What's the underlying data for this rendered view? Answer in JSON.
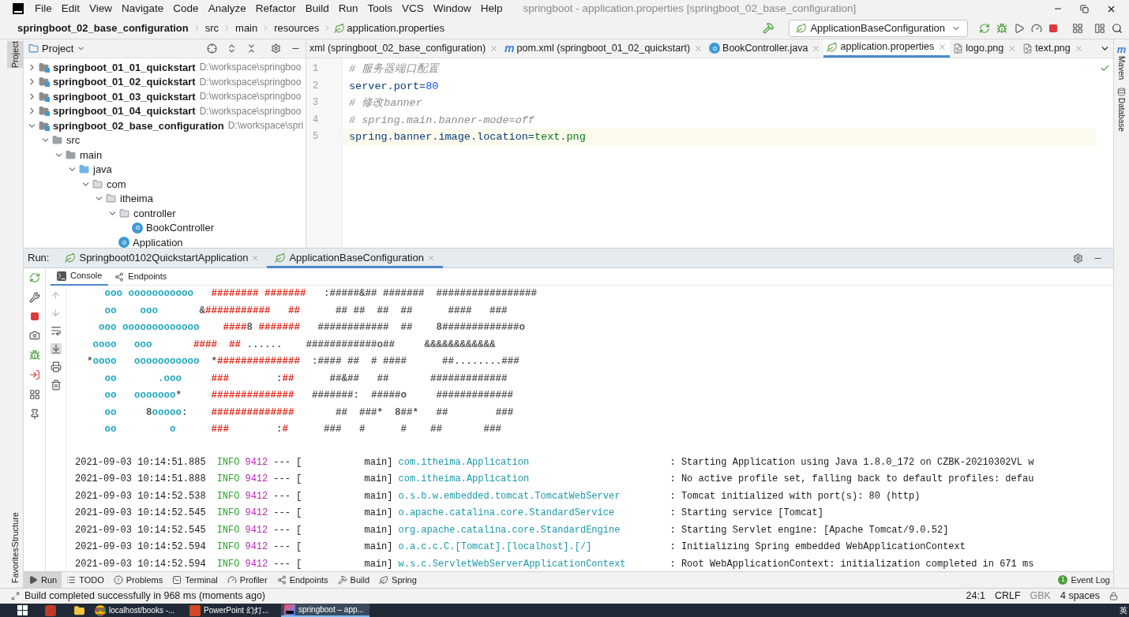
{
  "menu": [
    "File",
    "Edit",
    "View",
    "Navigate",
    "Code",
    "Analyze",
    "Refactor",
    "Build",
    "Run",
    "Tools",
    "VCS",
    "Window",
    "Help"
  ],
  "window_title": "springboot - application.properties [springboot_02_base_configuration]",
  "breadcrumb": [
    "springboot_02_base_configuration",
    "src",
    "main",
    "resources",
    "application.properties"
  ],
  "run_config": "ApplicationBaseConfiguration",
  "left_strip": {
    "top": [
      {
        "label": "Project",
        "selected": true
      }
    ],
    "bottom": [
      {
        "label": "Structure",
        "selected": false
      },
      {
        "label": "Favorites",
        "selected": false
      }
    ]
  },
  "right_strip": [
    {
      "label": "Maven",
      "kind": "maven",
      "icon_text": "m"
    },
    {
      "label": "Database",
      "kind": "database"
    }
  ],
  "project_panel": {
    "title": "Project",
    "tree": [
      {
        "label": "springboot_01_01_quickstart",
        "path": "D:\\workspace\\springboo",
        "kind": "module",
        "expanded": false
      },
      {
        "label": "springboot_01_02_quickstart",
        "path": "D:\\workspace\\springboo",
        "kind": "module",
        "expanded": false
      },
      {
        "label": "springboot_01_03_quickstart",
        "path": "D:\\workspace\\springboo",
        "kind": "module",
        "expanded": false
      },
      {
        "label": "springboot_01_04_quickstart",
        "path": "D:\\workspace\\springboo",
        "kind": "module",
        "expanded": false
      },
      {
        "label": "springboot_02_base_configuration",
        "path": "D:\\workspace\\spri",
        "kind": "module",
        "expanded": true,
        "children": [
          {
            "label": "src",
            "kind": "folder",
            "expanded": true,
            "children": [
              {
                "label": "main",
                "kind": "folder",
                "expanded": true,
                "children": [
                  {
                    "label": "java",
                    "kind": "source",
                    "expanded": true,
                    "children": [
                      {
                        "label": "com",
                        "kind": "package",
                        "expanded": true,
                        "children": [
                          {
                            "label": "itheima",
                            "kind": "package",
                            "expanded": true,
                            "children": [
                              {
                                "label": "controller",
                                "kind": "package",
                                "expanded": true,
                                "children": [
                                  {
                                    "label": "BookController",
                                    "kind": "class"
                                  }
                                ]
                              },
                              {
                                "label": "Application",
                                "kind": "main-class"
                              }
                            ]
                          }
                        ]
                      }
                    ]
                  }
                ]
              }
            ]
          }
        ]
      }
    ]
  },
  "editor_tabs": [
    {
      "label": "xml (springboot_02_base_configuration)",
      "kind": "none",
      "selected": false
    },
    {
      "label": "pom.xml (springboot_01_02_quickstart)",
      "kind": "maven",
      "icon_text": "m",
      "selected": false
    },
    {
      "label": "BookController.java",
      "kind": "class",
      "selected": false
    },
    {
      "label": "application.properties",
      "kind": "properties",
      "selected": true
    },
    {
      "label": "logo.png",
      "kind": "image",
      "selected": false
    },
    {
      "label": "text.png",
      "kind": "image",
      "selected": false
    }
  ],
  "editor": {
    "lines": [
      {
        "number": "1",
        "current": false,
        "segments": [
          {
            "kind": "comment",
            "text": "# 服务器端口配置"
          }
        ]
      },
      {
        "number": "2",
        "current": false,
        "segments": [
          {
            "kind": "key",
            "text": "server.port="
          },
          {
            "kind": "number",
            "text": "80"
          }
        ]
      },
      {
        "number": "3",
        "current": false,
        "segments": [
          {
            "kind": "comment",
            "text": "# 修改banner"
          }
        ]
      },
      {
        "number": "4",
        "current": false,
        "segments": [
          {
            "kind": "comment",
            "text": "# spring.main.banner-mode=off"
          }
        ]
      },
      {
        "number": "5",
        "current": true,
        "segments": [
          {
            "kind": "key",
            "text": "spring.banner.image.location="
          },
          {
            "kind": "string",
            "text": "text.png"
          }
        ]
      }
    ]
  },
  "run_panel": {
    "label": "Run:",
    "tabs": [
      {
        "label": "Springboot0102QuickstartApplication",
        "selected": false
      },
      {
        "label": "ApplicationBaseConfiguration",
        "selected": true
      }
    ],
    "subtabs": [
      {
        "label": "Console",
        "kind": "console",
        "selected": true
      },
      {
        "label": "Endpoints",
        "kind": "endpoints",
        "selected": false
      }
    ],
    "art": [
      [
        {
          "kind": "cyan",
          "text": "     ooo ooooooooooo   "
        },
        {
          "kind": "red",
          "text": "######## #######"
        },
        {
          "kind": "gray",
          "text": "   :#####&## #######  #################"
        }
      ],
      [
        {
          "kind": "cyan",
          "text": "     oo    ooo       "
        },
        {
          "kind": "gray",
          "text": "&"
        },
        {
          "kind": "red",
          "text": "###########   ##"
        },
        {
          "kind": "gray",
          "text": "      ## ##  ##  ##      ####   ###"
        }
      ],
      [
        {
          "kind": "cyan",
          "text": "    ooo ooooooooooooo    "
        },
        {
          "kind": "red",
          "text": "####"
        },
        {
          "kind": "gray",
          "text": "8 "
        },
        {
          "kind": "red",
          "text": "#######"
        },
        {
          "kind": "gray",
          "text": "   ############  ##    8#############o"
        }
      ],
      [
        {
          "kind": "cyan",
          "text": "   oooo   ooo       "
        },
        {
          "kind": "red",
          "text": "####  ##"
        },
        {
          "kind": "gray",
          "text": " ......    ############o##     &&&&&&&&&&&&"
        }
      ],
      [
        {
          "kind": "gray",
          "text": "  *"
        },
        {
          "kind": "cyan",
          "text": "oooo   ooooooooooo  "
        },
        {
          "kind": "gray",
          "text": "*"
        },
        {
          "kind": "red",
          "text": "##############"
        },
        {
          "kind": "gray",
          "text": "  :#### ##  # ####      ##........###"
        }
      ],
      [
        {
          "kind": "cyan",
          "text": "     oo       .ooo     "
        },
        {
          "kind": "red",
          "text": "###        "
        },
        {
          "kind": "gray",
          "text": ":"
        },
        {
          "kind": "red",
          "text": "##"
        },
        {
          "kind": "gray",
          "text": "      ##&##   ##       #############"
        }
      ],
      [
        {
          "kind": "cyan",
          "text": "     oo   ooooooo"
        },
        {
          "kind": "gray",
          "text": "*     "
        },
        {
          "kind": "red",
          "text": "##############"
        },
        {
          "kind": "gray",
          "text": "   #######:  #####o     #############"
        }
      ],
      [
        {
          "kind": "cyan",
          "text": "     oo     "
        },
        {
          "kind": "gray",
          "text": "8"
        },
        {
          "kind": "cyan",
          "text": "ooooo"
        },
        {
          "kind": "gray",
          "text": ":    "
        },
        {
          "kind": "red",
          "text": "##############"
        },
        {
          "kind": "gray",
          "text": "       ##  ###*  8##*   ##        ###"
        }
      ],
      [
        {
          "kind": "cyan",
          "text": "     oo         o      "
        },
        {
          "kind": "red",
          "text": "###        "
        },
        {
          "kind": "gray",
          "text": ":"
        },
        {
          "kind": "red",
          "text": "#"
        },
        {
          "kind": "gray",
          "text": "      ###   #      #    ##       ###"
        }
      ]
    ],
    "logs": [
      {
        "time": "2021-09-03 10:14:51.885",
        "level": "INFO",
        "pid": "9412",
        "thread": "--- [           main]",
        "logger": "com.itheima.Application",
        "message": ": Starting Application using Java 1.8.0_172 on CZBK-20210302VL w"
      },
      {
        "time": "2021-09-03 10:14:51.888",
        "level": "INFO",
        "pid": "9412",
        "thread": "--- [           main]",
        "logger": "com.itheima.Application",
        "message": ": No active profile set, falling back to default profiles: defau"
      },
      {
        "time": "2021-09-03 10:14:52.538",
        "level": "INFO",
        "pid": "9412",
        "thread": "--- [           main]",
        "logger": "o.s.b.w.embedded.tomcat.TomcatWebServer",
        "message": ": Tomcat initialized with port(s): 80 (http)"
      },
      {
        "time": "2021-09-03 10:14:52.545",
        "level": "INFO",
        "pid": "9412",
        "thread": "--- [           main]",
        "logger": "o.apache.catalina.core.StandardService",
        "message": ": Starting service [Tomcat]"
      },
      {
        "time": "2021-09-03 10:14:52.545",
        "level": "INFO",
        "pid": "9412",
        "thread": "--- [           main]",
        "logger": "org.apache.catalina.core.StandardEngine",
        "message": ": Starting Servlet engine: [Apache Tomcat/9.0.52]"
      },
      {
        "time": "2021-09-03 10:14:52.594",
        "level": "INFO",
        "pid": "9412",
        "thread": "--- [           main]",
        "logger": "o.a.c.c.C.[Tomcat].[localhost].[/]",
        "message": ": Initializing Spring embedded WebApplicationContext"
      },
      {
        "time": "2021-09-03 10:14:52.594",
        "level": "INFO",
        "pid": "9412",
        "thread": "--- [           main]",
        "logger": "w.s.c.ServletWebServerApplicationContext",
        "message": ": Root WebApplicationContext: initialization completed in 671 ms"
      }
    ]
  },
  "bottom_tools": [
    {
      "label": "Run",
      "kind": "run",
      "selected": true
    },
    {
      "label": "TODO",
      "kind": "todo",
      "selected": false
    },
    {
      "label": "Problems",
      "kind": "problems",
      "selected": false
    },
    {
      "label": "Terminal",
      "kind": "terminal",
      "selected": false
    },
    {
      "label": "Profiler",
      "kind": "profiler",
      "selected": false
    },
    {
      "label": "Endpoints",
      "kind": "endpoints",
      "selected": false
    },
    {
      "label": "Build",
      "kind": "build",
      "selected": false
    },
    {
      "label": "Spring",
      "kind": "spring",
      "selected": false
    }
  ],
  "event_log": {
    "count": "1",
    "label": "Event Log"
  },
  "status": {
    "message": "Build completed successfully in 968 ms (moments ago)",
    "position": "24:1",
    "line_separator": "CRLF",
    "encoding": "GBK",
    "indent": "4 spaces"
  },
  "taskbar": [
    {
      "label": "localhost/books -...",
      "kind": "chrome",
      "selected": false
    },
    {
      "label": "PowerPoint 幻灯...",
      "kind": "powerpoint",
      "selected": false
    },
    {
      "label": "springboot – app...",
      "kind": "idea",
      "selected": true
    }
  ],
  "tray": "英"
}
